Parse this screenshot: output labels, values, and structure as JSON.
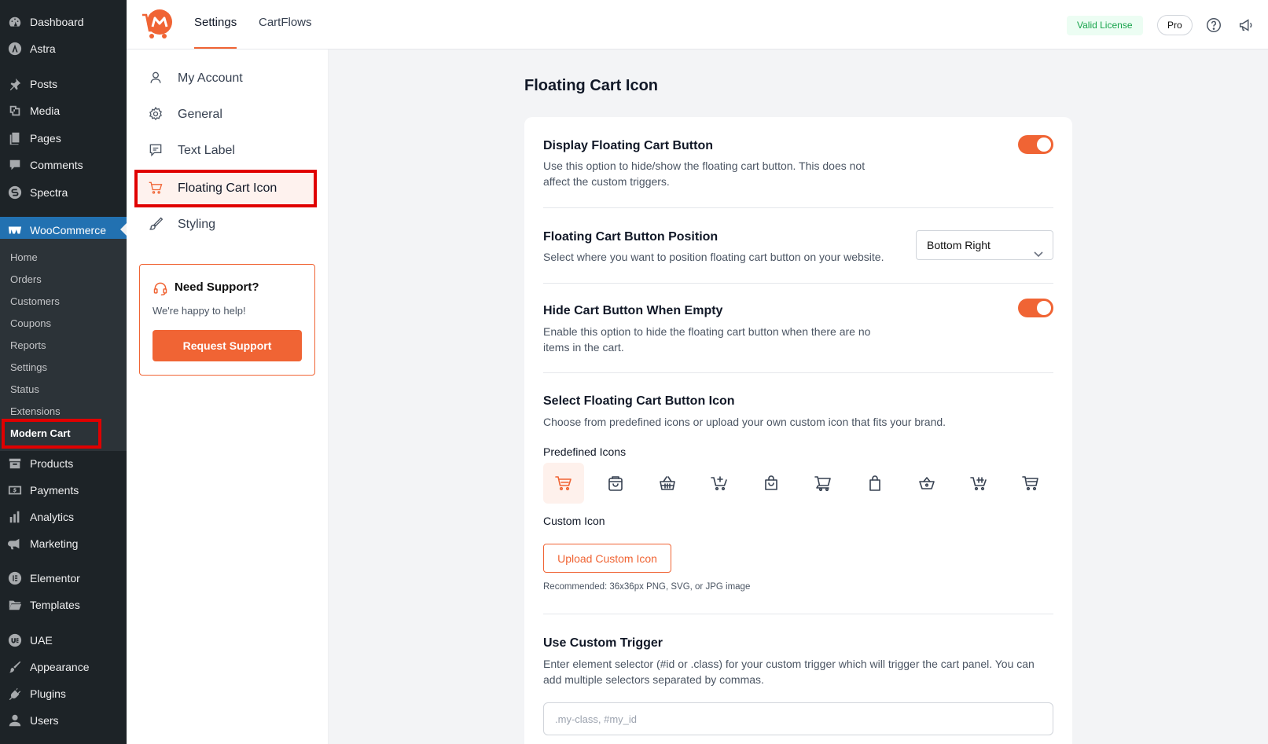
{
  "wp_menu": {
    "top": [
      {
        "label": "Dashboard",
        "icon": "dashboard-icon"
      },
      {
        "label": "Astra",
        "icon": "astra-icon"
      },
      {
        "label": "Posts",
        "icon": "pin-icon"
      },
      {
        "label": "Media",
        "icon": "media-icon"
      },
      {
        "label": "Pages",
        "icon": "pages-icon"
      },
      {
        "label": "Comments",
        "icon": "comment-icon"
      },
      {
        "label": "Spectra",
        "icon": "spectra-icon"
      }
    ],
    "woocommerce": {
      "label": "WooCommerce",
      "icon": "woocommerce-icon"
    },
    "submenu": [
      "Home",
      "Orders",
      "Customers",
      "Coupons",
      "Reports",
      "Settings",
      "Status",
      "Extensions",
      "Modern Cart"
    ],
    "bottom": [
      {
        "label": "Products",
        "icon": "archive-icon"
      },
      {
        "label": "Payments",
        "icon": "payments-icon"
      },
      {
        "label": "Analytics",
        "icon": "analytics-icon"
      },
      {
        "label": "Marketing",
        "icon": "megaphone-icon"
      },
      {
        "label": "Elementor",
        "icon": "elementor-icon"
      },
      {
        "label": "Templates",
        "icon": "folder-icon"
      },
      {
        "label": "UAE",
        "icon": "uae-icon"
      },
      {
        "label": "Appearance",
        "icon": "brush-icon"
      },
      {
        "label": "Plugins",
        "icon": "plug-icon"
      },
      {
        "label": "Users",
        "icon": "user-icon"
      }
    ]
  },
  "topbar": {
    "tabs": [
      "Settings",
      "CartFlows"
    ],
    "license": "Valid License",
    "pro": "Pro"
  },
  "settings_nav": {
    "items": [
      "My Account",
      "General",
      "Text Label",
      "Floating Cart Icon",
      "Styling"
    ],
    "support": {
      "title": "Need Support?",
      "subtitle": "We're happy to help!",
      "button": "Request Support"
    }
  },
  "main": {
    "title": "Floating Cart Icon",
    "display": {
      "title": "Display Floating Cart Button",
      "desc_line1": "Use this option to hide/show the floating cart button. This does not",
      "desc_line2": "affect the custom triggers.",
      "enabled": true
    },
    "position": {
      "title": "Floating Cart Button Position",
      "desc": "Select where you want to position floating cart button on your website.",
      "value": "Bottom Right"
    },
    "hide_empty": {
      "title": "Hide Cart Button When Empty",
      "desc_line1": "Enable this option to hide the floating cart button when there are no",
      "desc_line2": "items in the cart.",
      "enabled": true
    },
    "icon_select": {
      "title": "Select Floating Cart Button Icon",
      "desc": "Choose from predefined icons or upload your own custom icon that fits your brand.",
      "predefined_label": "Predefined Icons",
      "custom_label": "Custom Icon",
      "upload_button": "Upload Custom Icon",
      "recommend": "Recommended: 36x36px PNG, SVG, or JPG image"
    },
    "trigger": {
      "title": "Use Custom Trigger",
      "desc_line1": "Enter element selector (#id or .class) for your custom trigger which will trigger the cart panel. You can",
      "desc_line2": "add multiple selectors separated by commas.",
      "placeholder": ".my-class, #my_id"
    }
  },
  "colors": {
    "accent": "#f06434",
    "wp_sidebar": "#1d2327",
    "wp_active": "#2271b1",
    "highlight": "#e00000"
  }
}
